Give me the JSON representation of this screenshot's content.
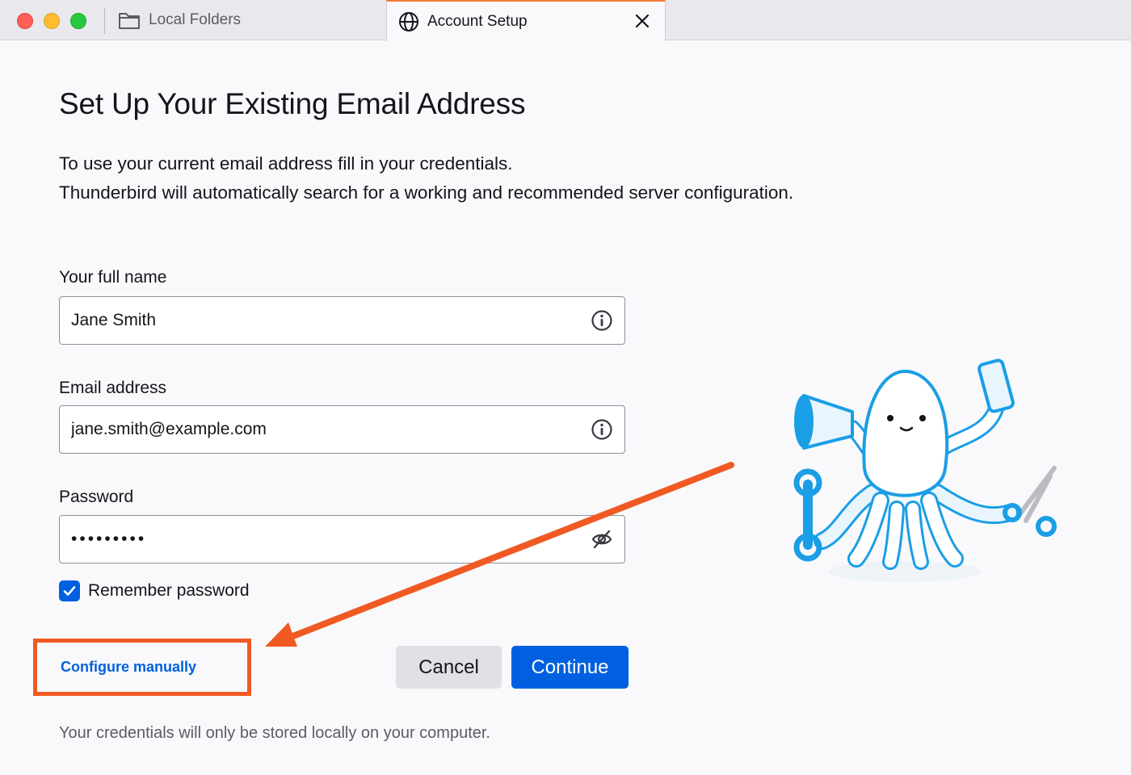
{
  "tabs": {
    "local_folders": "Local Folders",
    "account_setup": "Account Setup"
  },
  "page": {
    "title": "Set Up Your Existing Email Address",
    "intro_line1": "To use your current email address fill in your credentials.",
    "intro_line2": "Thunderbird will automatically search for a working and recommended server configuration."
  },
  "form": {
    "name_label": "Your full name",
    "name_value": "Jane Smith",
    "email_label": "Email address",
    "email_value": "jane.smith@example.com",
    "password_label": "Password",
    "password_value": "•••••••••",
    "remember_label": "Remember password",
    "remember_checked": true
  },
  "actions": {
    "configure_manually": "Configure manually",
    "cancel": "Cancel",
    "continue": "Continue"
  },
  "footnote": "Your credentials will only be stored locally on your computer.",
  "icons": {
    "folder": "folder-icon",
    "globe": "globe-icon",
    "close": "close-icon",
    "info": "info-icon",
    "eye_slash": "eye-slash-icon",
    "check": "checkmark-icon"
  },
  "colors": {
    "accent": "#0060df",
    "highlight": "#f05a22",
    "tab_accent": "#f47a36"
  }
}
